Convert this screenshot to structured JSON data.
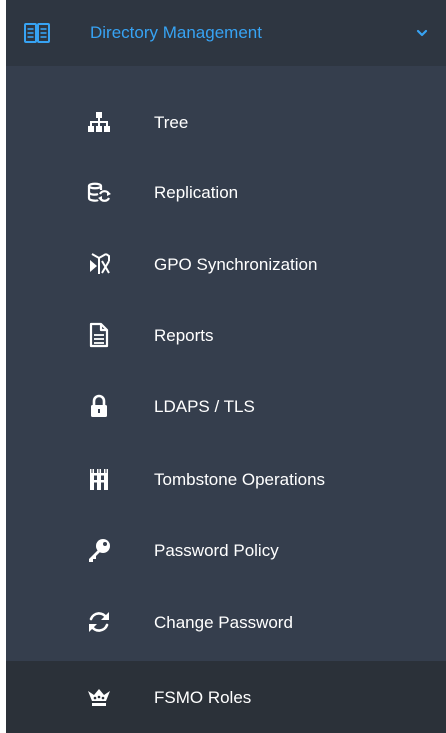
{
  "menu": {
    "header": {
      "label": "Directory Management",
      "icon": "book-icon",
      "chevron": "chevron-down-icon",
      "accent": "#37a3f3"
    },
    "items": [
      {
        "label": "Tree",
        "icon": "sitemap-icon"
      },
      {
        "label": "Replication",
        "icon": "database-sync-icon"
      },
      {
        "label": "GPO Synchronization",
        "icon": "gpo-sync-icon"
      },
      {
        "label": "Reports",
        "icon": "document-icon"
      },
      {
        "label": "LDAPS / TLS",
        "icon": "lock-icon"
      },
      {
        "label": "Tombstone Operations",
        "icon": "tombstone-icon"
      },
      {
        "label": "Password Policy",
        "icon": "key-icon"
      },
      {
        "label": "Change Password",
        "icon": "sync-arrows-icon"
      },
      {
        "label": "FSMO Roles",
        "icon": "crown-icon",
        "active": true
      }
    ],
    "colors": {
      "background": "#353e4d",
      "header_background": "#2e3641",
      "active_background": "#2b3139",
      "text": "#ffffff"
    }
  }
}
